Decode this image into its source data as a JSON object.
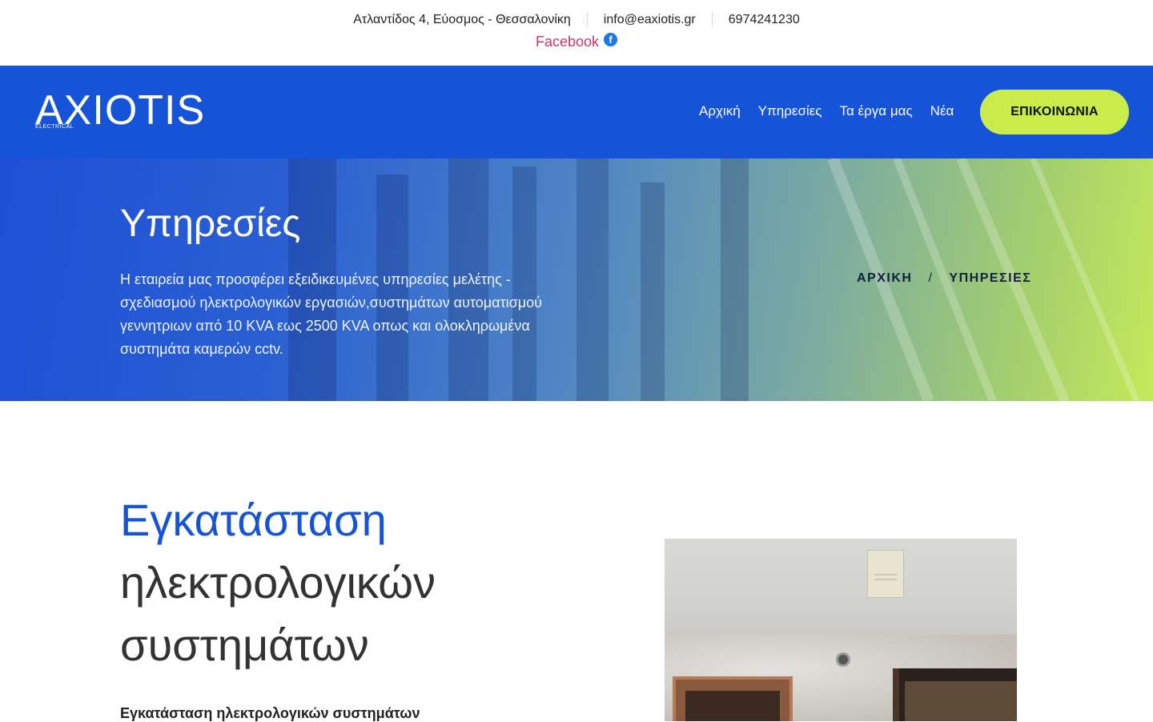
{
  "topbar": {
    "address": "Ατλαντίδος 4, Εύοσμος - Θεσσαλονίκη",
    "email": "info@eaxiotis.gr",
    "phone": "6974241230",
    "facebook_label": "Facebook",
    "facebook_icon": "facebook-icon"
  },
  "header": {
    "logo_text": "AXIOTIS",
    "logo_sub": "ELECTRICAL",
    "nav": [
      {
        "label": "Αρχική"
      },
      {
        "label": "Υπηρεσίες"
      },
      {
        "label": "Τα έργα μας"
      },
      {
        "label": "Νέα"
      }
    ],
    "cta_label": "ΕΠΙΚΟΙΝΩΝΙΑ",
    "colors": {
      "background": "#1553d8",
      "cta": "#c9ec4a"
    }
  },
  "hero": {
    "title": "Υπηρεσίες",
    "description": "Η εταιρεία μας προσφέρει εξειδικευμένες υπηρεσίες μελέτης - σχεδιασμού ηλεκτρολογικών εργασιών,συστημάτων αυτοματισμού γεννητριων από 10 KVA εως 2500 KVA οπως και ολοκληρωμένα συστημάτα καμερών cctv.",
    "breadcrumb": [
      {
        "label": "ΑΡΧΙΚΗ"
      },
      {
        "label": "ΥΠΗΡΕΣΙΕΣ"
      }
    ],
    "breadcrumb_separator": "/"
  },
  "section": {
    "title_accent": "Εγκατάσταση",
    "title_rest": "ηλεκτρολογικών συστημάτων",
    "subtitle": "Εγκατάσταση ηλεκτρολογικών συστημάτων",
    "accent_color": "#1553d8"
  }
}
